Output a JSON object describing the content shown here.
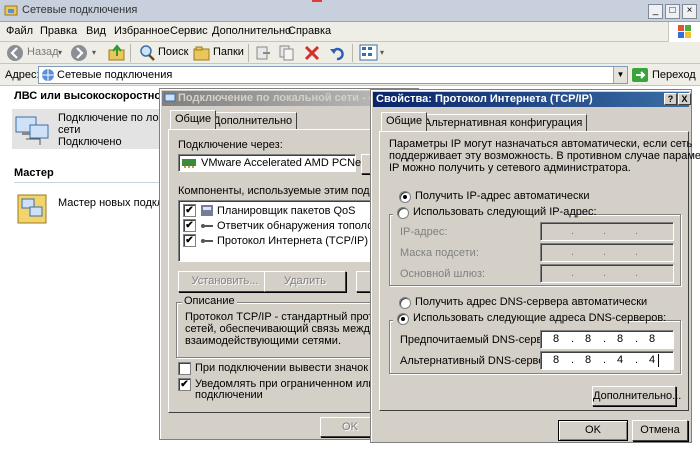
{
  "window": {
    "title": "Сетевые подключения"
  },
  "menu": {
    "items": [
      "Файл",
      "Правка",
      "Вид",
      "Избранное",
      "Сервис",
      "Дополнительно",
      "Справка"
    ]
  },
  "toolbar": {
    "back": "Назад",
    "search": "Поиск",
    "folders": "Папки"
  },
  "address": {
    "label": "Адрес:",
    "value": "Сетевые подключения",
    "go": "Переход"
  },
  "explorer": {
    "group1_title": "ЛВС или высокоскоростной Инте",
    "connection_name_1": "Подключение по локаль",
    "connection_name_2": "сети",
    "connection_status": "Подключено",
    "group2_title": "Мастер",
    "wizard_label": "Мастер новых подключе"
  },
  "lan_dialog": {
    "title": "Подключение по локальной сети - свойст",
    "tabs": [
      "Общие",
      "Дополнительно"
    ],
    "connect_using_label": "Подключение через:",
    "adapter": "VMware Accelerated AMD PCNet Ad",
    "components_label": "Компоненты, используемые этим подключение",
    "components": [
      {
        "label": "Планировщик пакетов QoS",
        "checked": true,
        "icon": "qos-scheduler-icon"
      },
      {
        "label": "Ответчик обнаружения топологии уров",
        "checked": true,
        "icon": "topology-responder-icon"
      },
      {
        "label": "Протокол Интернета (TCP/IP)",
        "checked": true,
        "icon": "network-protocol-icon"
      }
    ],
    "install_button": "Установить...",
    "remove_button": "Удалить",
    "description_legend": "Описание",
    "description_lines": [
      "Протокол TCP/IP - стандартный протокол гл",
      "сетей, обеспечивающий связь между разли",
      "взаимодействующими сетями."
    ],
    "show_icon_label": "При подключении вывести значок в области",
    "show_icon_checked": false,
    "notify_label_1": "Уведомлять при ограниченном или отсутст",
    "notify_label_2": "подключении",
    "notify_checked": true,
    "ok_button": "OK"
  },
  "tcpip_dialog": {
    "title": "Свойства: Протокол Интернета (TCP/IP)",
    "help_button": "?",
    "close_button": "X",
    "tabs": [
      "Общие",
      "Альтернативная конфигурация"
    ],
    "info_lines": [
      "Параметры IP могут назначаться автоматически, если сеть",
      "поддерживает эту возможность. В противном случае параметры",
      "IP можно получить у сетевого администратора."
    ],
    "ip_auto_label": "Получить IP-адрес автоматически",
    "ip_auto_selected": true,
    "ip_manual_label": "Использовать следующий IP-адрес:",
    "ip_address_label": "IP-адрес:",
    "subnet_label": "Маска подсети:",
    "gateway_label": "Основной шлюз:",
    "dns_auto_label": "Получить адрес DNS-сервера автоматически",
    "dns_manual_label": "Использовать следующие адреса DNS-серверов:",
    "dns_manual_selected": true,
    "preferred_dns_label": "Предпочитаемый DNS-сервер:",
    "preferred_dns": [
      "8",
      "8",
      "8",
      "8"
    ],
    "alternate_dns_label": "Альтернативный DNS-сервер:",
    "alternate_dns": [
      "8",
      "8",
      "4",
      "4"
    ],
    "advanced_button": "Дополнительно...",
    "ok_button": "OK",
    "cancel_button": "Отмена"
  },
  "colors": {
    "title_active": "#0a246a",
    "title_inactive": "#808080",
    "dialog_face": "#d4d0c8",
    "xp_bar": "#efeee6"
  }
}
